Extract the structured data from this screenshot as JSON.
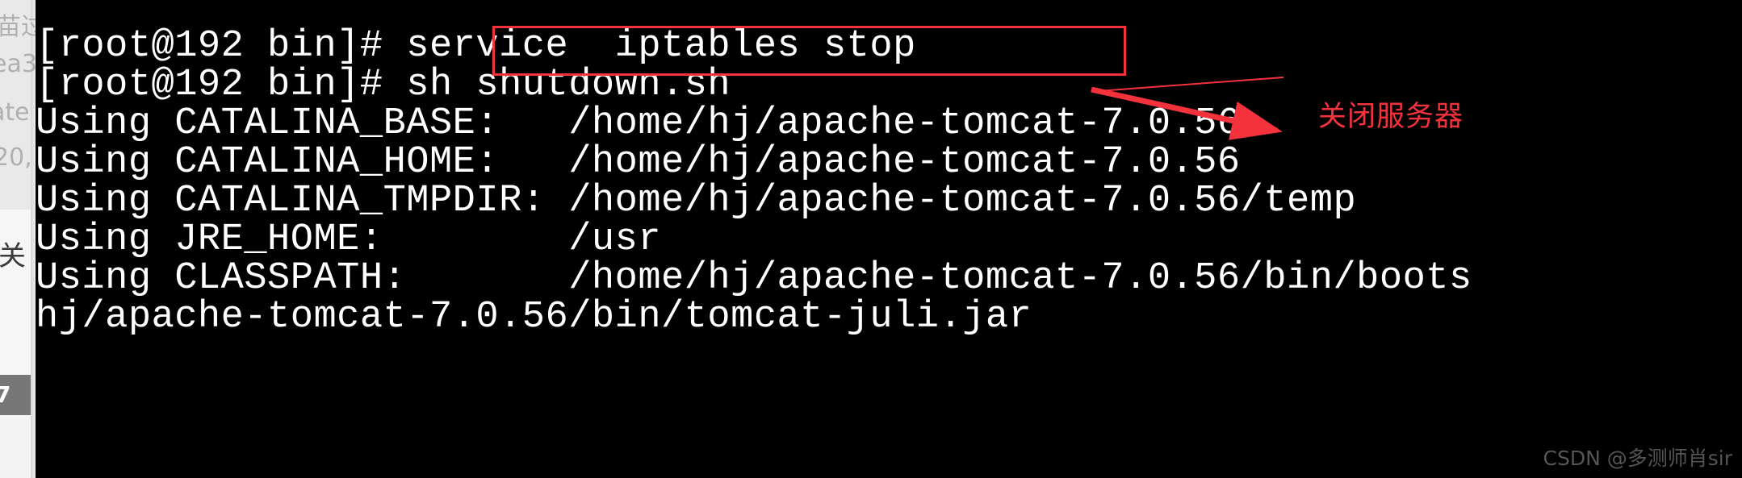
{
  "window": {
    "kind": "terminal",
    "background_color": "#000000",
    "text_color": "#ffffff"
  },
  "background_window": {
    "fragments": [
      {
        "text": "苗过"
      },
      {
        "text": "ea3"
      },
      {
        "text": "ate"
      },
      {
        "text": "20,"
      },
      {
        "text": "关"
      },
      {
        "text": "7"
      }
    ]
  },
  "terminal": {
    "lines": [
      {
        "text": "[root@192 bin]# service  iptables stop"
      },
      {
        "text": "[root@192 bin]# sh shutdown.sh"
      },
      {
        "text": "Using CATALINA_BASE:   /home/hj/apache-tomcat-7.0.56"
      },
      {
        "text": "Using CATALINA_HOME:   /home/hj/apache-tomcat-7.0.56"
      },
      {
        "text": "Using CATALINA_TMPDIR: /home/hj/apache-tomcat-7.0.56/temp"
      },
      {
        "text": "Using JRE_HOME:        /usr"
      },
      {
        "text": "Using CLASSPATH:       /home/hj/apache-tomcat-7.0.56/bin/boots"
      },
      {
        "text": "hj/apache-tomcat-7.0.56/bin/tomcat-juli.jar"
      }
    ],
    "prompt": "[root@192 bin]#",
    "command_highlighted": "service  iptables stop",
    "command_second": "sh shutdown.sh"
  },
  "annotation": {
    "color": "#f4323c",
    "label": "关闭服务器",
    "box_target": "service  iptables stop"
  },
  "watermark": {
    "text": "CSDN @多测师肖sir"
  }
}
